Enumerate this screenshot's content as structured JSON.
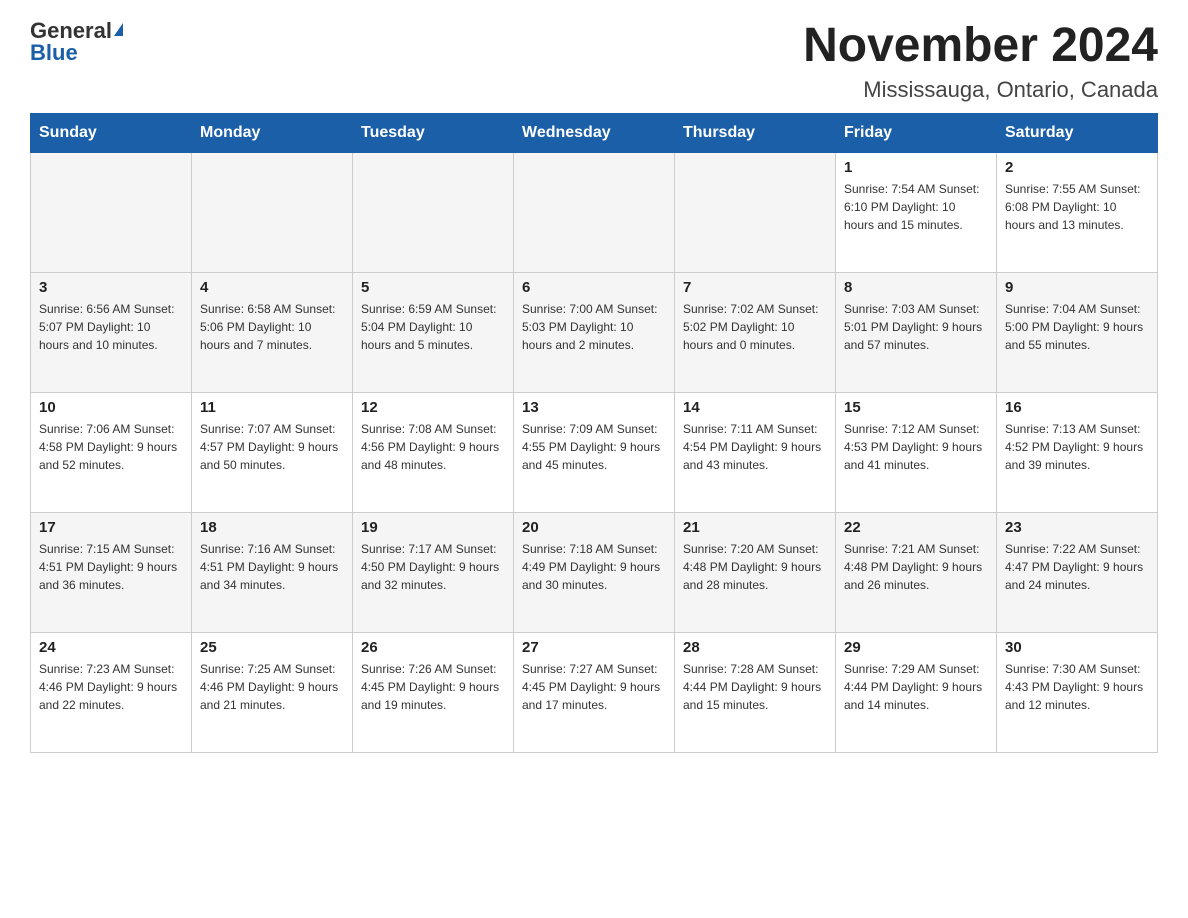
{
  "logo": {
    "general": "General",
    "blue": "Blue"
  },
  "title": "November 2024",
  "subtitle": "Mississauga, Ontario, Canada",
  "days_header": [
    "Sunday",
    "Monday",
    "Tuesday",
    "Wednesday",
    "Thursday",
    "Friday",
    "Saturday"
  ],
  "weeks": [
    [
      {
        "day": "",
        "info": ""
      },
      {
        "day": "",
        "info": ""
      },
      {
        "day": "",
        "info": ""
      },
      {
        "day": "",
        "info": ""
      },
      {
        "day": "",
        "info": ""
      },
      {
        "day": "1",
        "info": "Sunrise: 7:54 AM\nSunset: 6:10 PM\nDaylight: 10 hours and 15 minutes."
      },
      {
        "day": "2",
        "info": "Sunrise: 7:55 AM\nSunset: 6:08 PM\nDaylight: 10 hours and 13 minutes."
      }
    ],
    [
      {
        "day": "3",
        "info": "Sunrise: 6:56 AM\nSunset: 5:07 PM\nDaylight: 10 hours and 10 minutes."
      },
      {
        "day": "4",
        "info": "Sunrise: 6:58 AM\nSunset: 5:06 PM\nDaylight: 10 hours and 7 minutes."
      },
      {
        "day": "5",
        "info": "Sunrise: 6:59 AM\nSunset: 5:04 PM\nDaylight: 10 hours and 5 minutes."
      },
      {
        "day": "6",
        "info": "Sunrise: 7:00 AM\nSunset: 5:03 PM\nDaylight: 10 hours and 2 minutes."
      },
      {
        "day": "7",
        "info": "Sunrise: 7:02 AM\nSunset: 5:02 PM\nDaylight: 10 hours and 0 minutes."
      },
      {
        "day": "8",
        "info": "Sunrise: 7:03 AM\nSunset: 5:01 PM\nDaylight: 9 hours and 57 minutes."
      },
      {
        "day": "9",
        "info": "Sunrise: 7:04 AM\nSunset: 5:00 PM\nDaylight: 9 hours and 55 minutes."
      }
    ],
    [
      {
        "day": "10",
        "info": "Sunrise: 7:06 AM\nSunset: 4:58 PM\nDaylight: 9 hours and 52 minutes."
      },
      {
        "day": "11",
        "info": "Sunrise: 7:07 AM\nSunset: 4:57 PM\nDaylight: 9 hours and 50 minutes."
      },
      {
        "day": "12",
        "info": "Sunrise: 7:08 AM\nSunset: 4:56 PM\nDaylight: 9 hours and 48 minutes."
      },
      {
        "day": "13",
        "info": "Sunrise: 7:09 AM\nSunset: 4:55 PM\nDaylight: 9 hours and 45 minutes."
      },
      {
        "day": "14",
        "info": "Sunrise: 7:11 AM\nSunset: 4:54 PM\nDaylight: 9 hours and 43 minutes."
      },
      {
        "day": "15",
        "info": "Sunrise: 7:12 AM\nSunset: 4:53 PM\nDaylight: 9 hours and 41 minutes."
      },
      {
        "day": "16",
        "info": "Sunrise: 7:13 AM\nSunset: 4:52 PM\nDaylight: 9 hours and 39 minutes."
      }
    ],
    [
      {
        "day": "17",
        "info": "Sunrise: 7:15 AM\nSunset: 4:51 PM\nDaylight: 9 hours and 36 minutes."
      },
      {
        "day": "18",
        "info": "Sunrise: 7:16 AM\nSunset: 4:51 PM\nDaylight: 9 hours and 34 minutes."
      },
      {
        "day": "19",
        "info": "Sunrise: 7:17 AM\nSunset: 4:50 PM\nDaylight: 9 hours and 32 minutes."
      },
      {
        "day": "20",
        "info": "Sunrise: 7:18 AM\nSunset: 4:49 PM\nDaylight: 9 hours and 30 minutes."
      },
      {
        "day": "21",
        "info": "Sunrise: 7:20 AM\nSunset: 4:48 PM\nDaylight: 9 hours and 28 minutes."
      },
      {
        "day": "22",
        "info": "Sunrise: 7:21 AM\nSunset: 4:48 PM\nDaylight: 9 hours and 26 minutes."
      },
      {
        "day": "23",
        "info": "Sunrise: 7:22 AM\nSunset: 4:47 PM\nDaylight: 9 hours and 24 minutes."
      }
    ],
    [
      {
        "day": "24",
        "info": "Sunrise: 7:23 AM\nSunset: 4:46 PM\nDaylight: 9 hours and 22 minutes."
      },
      {
        "day": "25",
        "info": "Sunrise: 7:25 AM\nSunset: 4:46 PM\nDaylight: 9 hours and 21 minutes."
      },
      {
        "day": "26",
        "info": "Sunrise: 7:26 AM\nSunset: 4:45 PM\nDaylight: 9 hours and 19 minutes."
      },
      {
        "day": "27",
        "info": "Sunrise: 7:27 AM\nSunset: 4:45 PM\nDaylight: 9 hours and 17 minutes."
      },
      {
        "day": "28",
        "info": "Sunrise: 7:28 AM\nSunset: 4:44 PM\nDaylight: 9 hours and 15 minutes."
      },
      {
        "day": "29",
        "info": "Sunrise: 7:29 AM\nSunset: 4:44 PM\nDaylight: 9 hours and 14 minutes."
      },
      {
        "day": "30",
        "info": "Sunrise: 7:30 AM\nSunset: 4:43 PM\nDaylight: 9 hours and 12 minutes."
      }
    ]
  ]
}
